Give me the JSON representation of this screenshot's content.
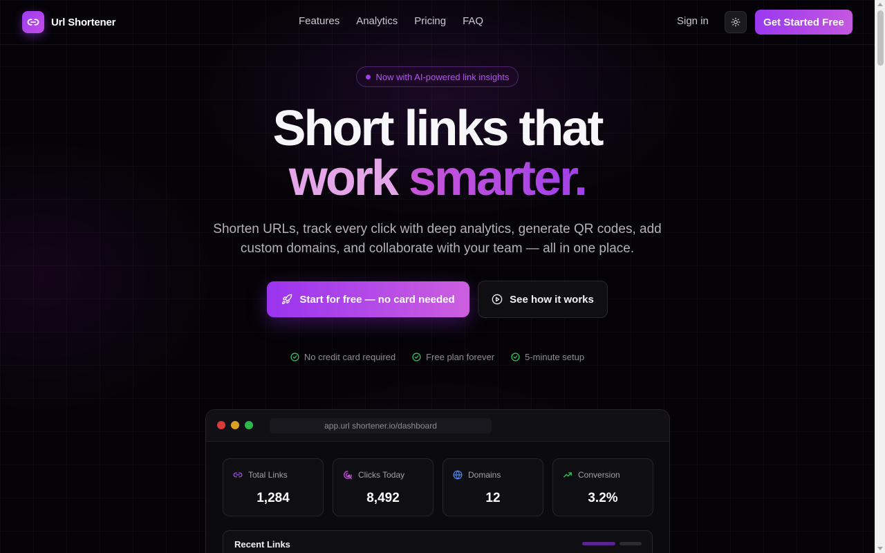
{
  "brand": {
    "name": "Url Shortener",
    "accent": "#a23ef0"
  },
  "nav": {
    "links": [
      "Features",
      "Analytics",
      "Pricing",
      "FAQ"
    ],
    "signin": "Sign in",
    "theme_icon": "sun-icon",
    "cta": "Get Started Free"
  },
  "hero": {
    "badge": "Now with AI-powered link insights",
    "title_line1": "Short links that",
    "title_word1": "work",
    "title_word2": "smarter.",
    "subtitle": "Shorten URLs, track every click with deep analytics, generate QR codes, add custom domains, and collaborate with your team — all in one place.",
    "primary_cta": "Start for free — no card needed",
    "secondary_cta": "See how it works",
    "checks": [
      "No credit card required",
      "Free plan forever",
      "5-minute setup"
    ]
  },
  "preview": {
    "url": "app.url shortener.io/dashboard",
    "stats": [
      {
        "label": "Total Links",
        "value": "1,284",
        "icon": "link-icon"
      },
      {
        "label": "Clicks Today",
        "value": "8,492",
        "icon": "click-icon"
      },
      {
        "label": "Domains",
        "value": "12",
        "icon": "globe-icon"
      },
      {
        "label": "Conversion",
        "value": "3.2%",
        "icon": "trend-up-icon"
      }
    ],
    "recent_title": "Recent Links"
  }
}
